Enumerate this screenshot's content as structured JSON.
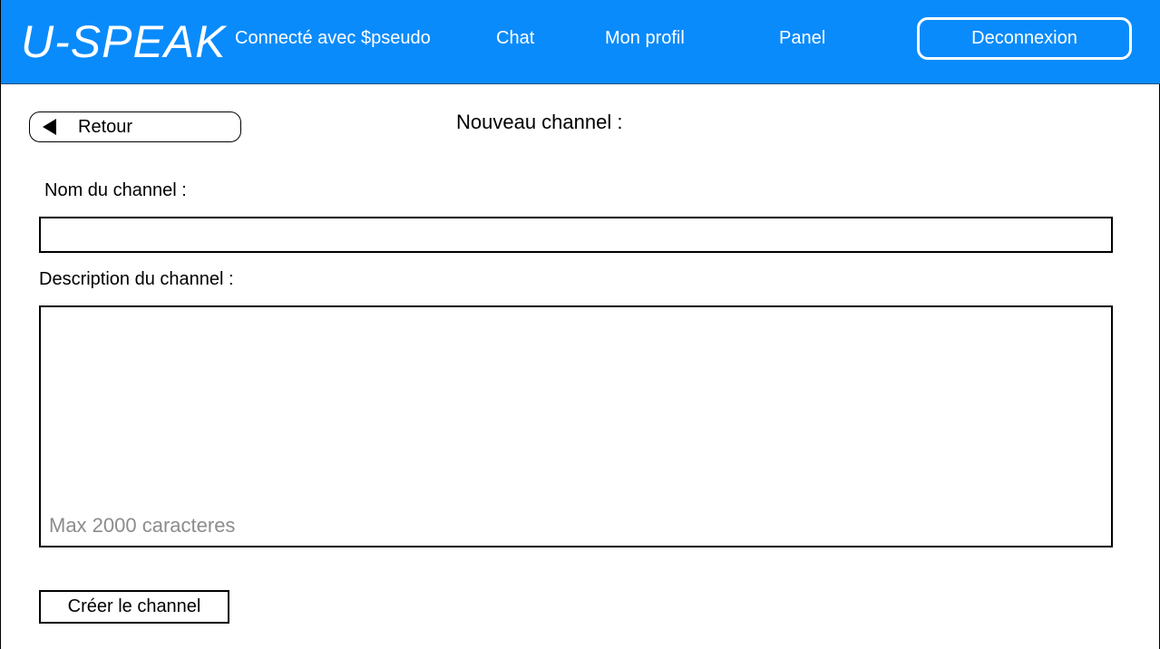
{
  "header": {
    "logo": "U-SPEAK",
    "status": "Connecté avec $pseudo",
    "nav": {
      "chat": "Chat",
      "profile": "Mon profil",
      "panel": "Panel"
    },
    "logout_label": "Deconnexion",
    "background_color": "#0a8bfb"
  },
  "back_button": {
    "label": "Retour",
    "icon": "triangle-left-icon"
  },
  "page_title": "Nouveau channel :",
  "form": {
    "name_label": "Nom du channel :",
    "name_value": "",
    "description_label": "Description du channel :",
    "description_placeholder": "Max 2000 caracteres",
    "submit_label": "Créer le channel"
  }
}
